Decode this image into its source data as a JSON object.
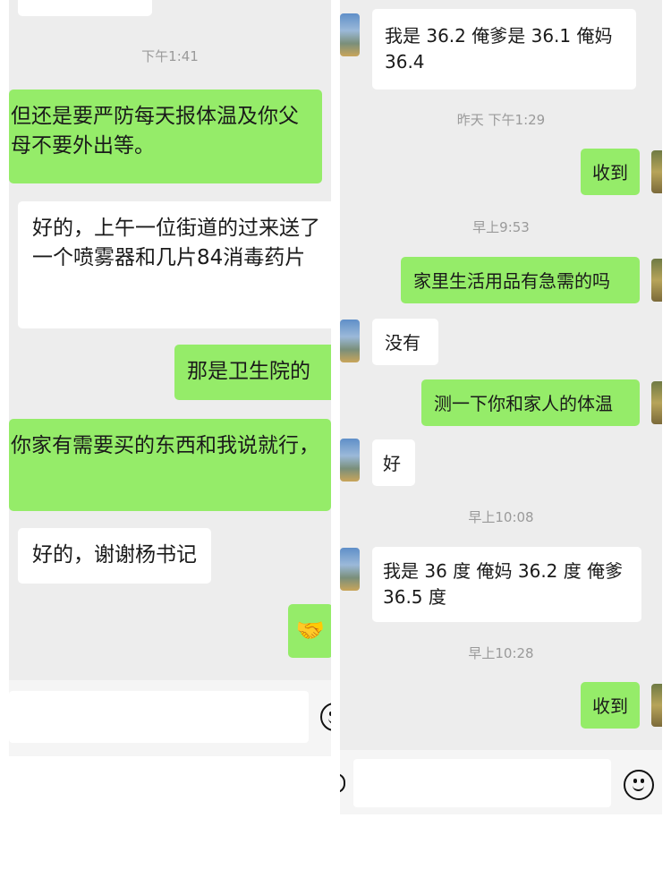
{
  "left": {
    "timestamp": "下午1:41",
    "messages": [
      {
        "from": "me",
        "text": "但还是要严防每天报体温及你父母不要外出等。"
      },
      {
        "from": "them",
        "text": "好的，上午一位街道的过来送了一个喷雾器和几片84消毒药片"
      },
      {
        "from": "me",
        "text": "那是卫生院的"
      },
      {
        "from": "me",
        "text": "你家有需要买的东西和我说就行，"
      },
      {
        "from": "them",
        "text": "好的，谢谢杨书记"
      },
      {
        "from": "me",
        "text": "🤝"
      }
    ]
  },
  "right": {
    "messages": [
      {
        "from": "them",
        "text": "我是 36.2  俺爹是 36.1  俺妈 36.4"
      },
      {
        "from": "me",
        "text": "收到"
      },
      {
        "from": "me",
        "text": "家里生活用品有急需的吗"
      },
      {
        "from": "them",
        "text": "没有"
      },
      {
        "from": "me",
        "text": "测一下你和家人的体温"
      },
      {
        "from": "them",
        "text": "好"
      },
      {
        "from": "them",
        "text": "我是 36 度  俺妈 36.2 度 俺爹 36.5 度"
      },
      {
        "from": "me",
        "text": "收到"
      }
    ],
    "timestamps": [
      "昨天 下午1:29",
      "早上9:53",
      "早上10:08",
      "早上10:28"
    ]
  },
  "icons": {
    "emoji": "smiley-face-icon",
    "handshake": "handshake-emoji"
  },
  "colors": {
    "background": "#ededed",
    "sent_bubble": "#95ec69",
    "received_bubble": "#ffffff",
    "timestamp": "#9a9a9a"
  }
}
